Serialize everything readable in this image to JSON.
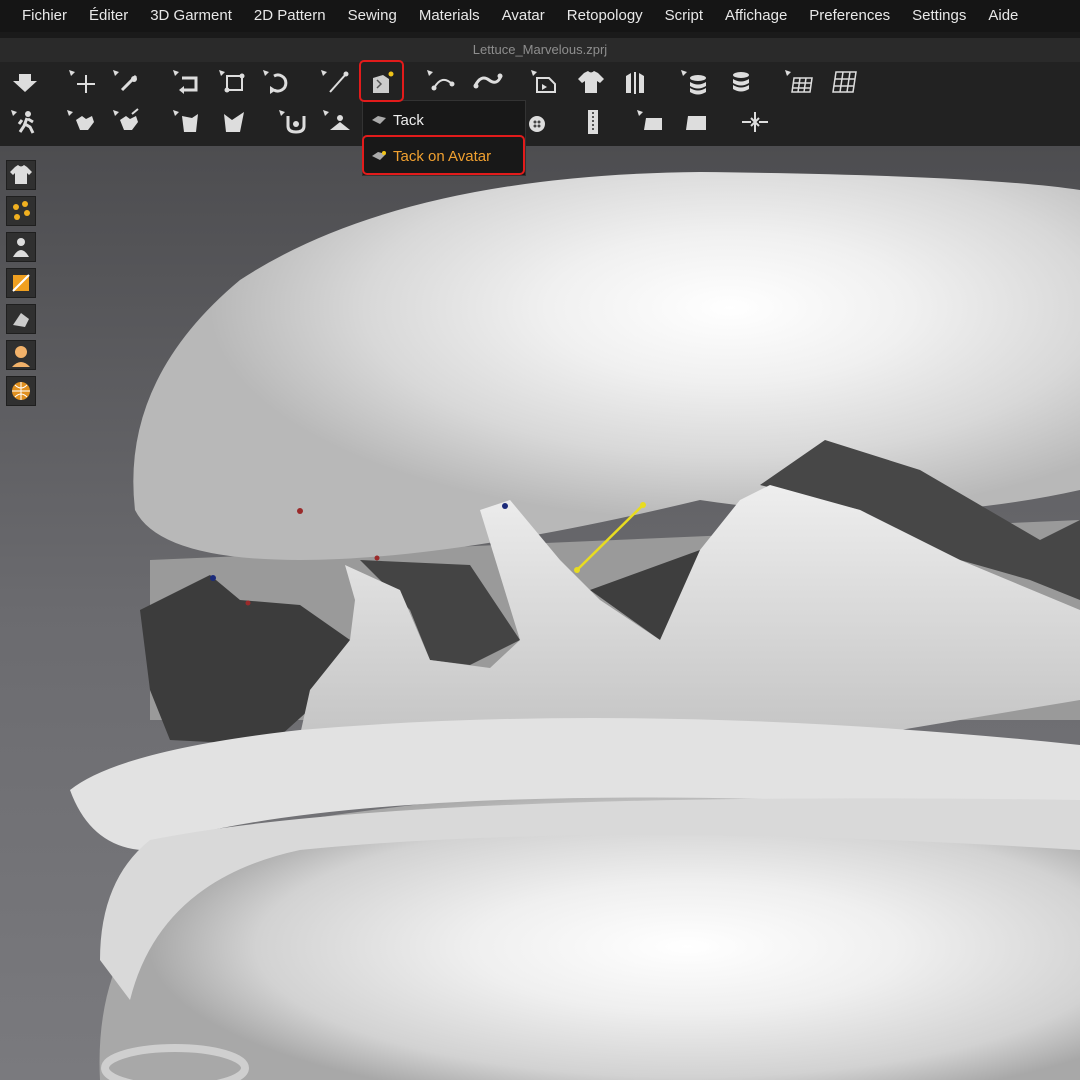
{
  "menu": [
    "Fichier",
    "Éditer",
    "3D Garment",
    "2D Pattern",
    "Sewing",
    "Materials",
    "Avatar",
    "Retopology",
    "Script",
    "Affichage",
    "Preferences",
    "Settings",
    "Aide"
  ],
  "file_title": "Lettuce_Marvelous.zprj",
  "dropdown": {
    "items": [
      {
        "label": "Tack",
        "icon": "tack-icon"
      },
      {
        "label": "Tack on Avatar",
        "icon": "tack-on-avatar-icon"
      }
    ],
    "active_color": "#f0a030"
  },
  "highlight_color": "#e21b1b",
  "toolbar_row1_icons": [
    "down-arrow-icon",
    "move-cross-icon",
    "edit-pin-icon",
    "rotate-icon",
    "transform-icon",
    "rotate-3d-icon",
    "pin-needle-icon",
    "tack-tool-icon",
    "sewing-line-icon",
    "free-sewing-icon",
    "fold-icon",
    "shirt-icon",
    "garment-split-icon",
    "stack-icon",
    "layer-icon",
    "grid-icon",
    "grid-tilt-icon"
  ],
  "toolbar_row2_icons": [
    "avatar-walk-icon",
    "select-mesh-icon",
    "edit-mesh-icon",
    "pattern-arrow-icon",
    "pattern-fold-icon",
    "button-icon",
    "hanger-icon",
    "button-round-icon",
    "zipper-icon",
    "flat-panel-icon",
    "panel-icon",
    "merge-arrows-icon"
  ],
  "sidebar_icons": [
    "shirt-view-icon",
    "points-icon",
    "avatar-view-icon",
    "texture-icon",
    "mesh-icon",
    "avatar-head-icon",
    "globe-icon"
  ]
}
